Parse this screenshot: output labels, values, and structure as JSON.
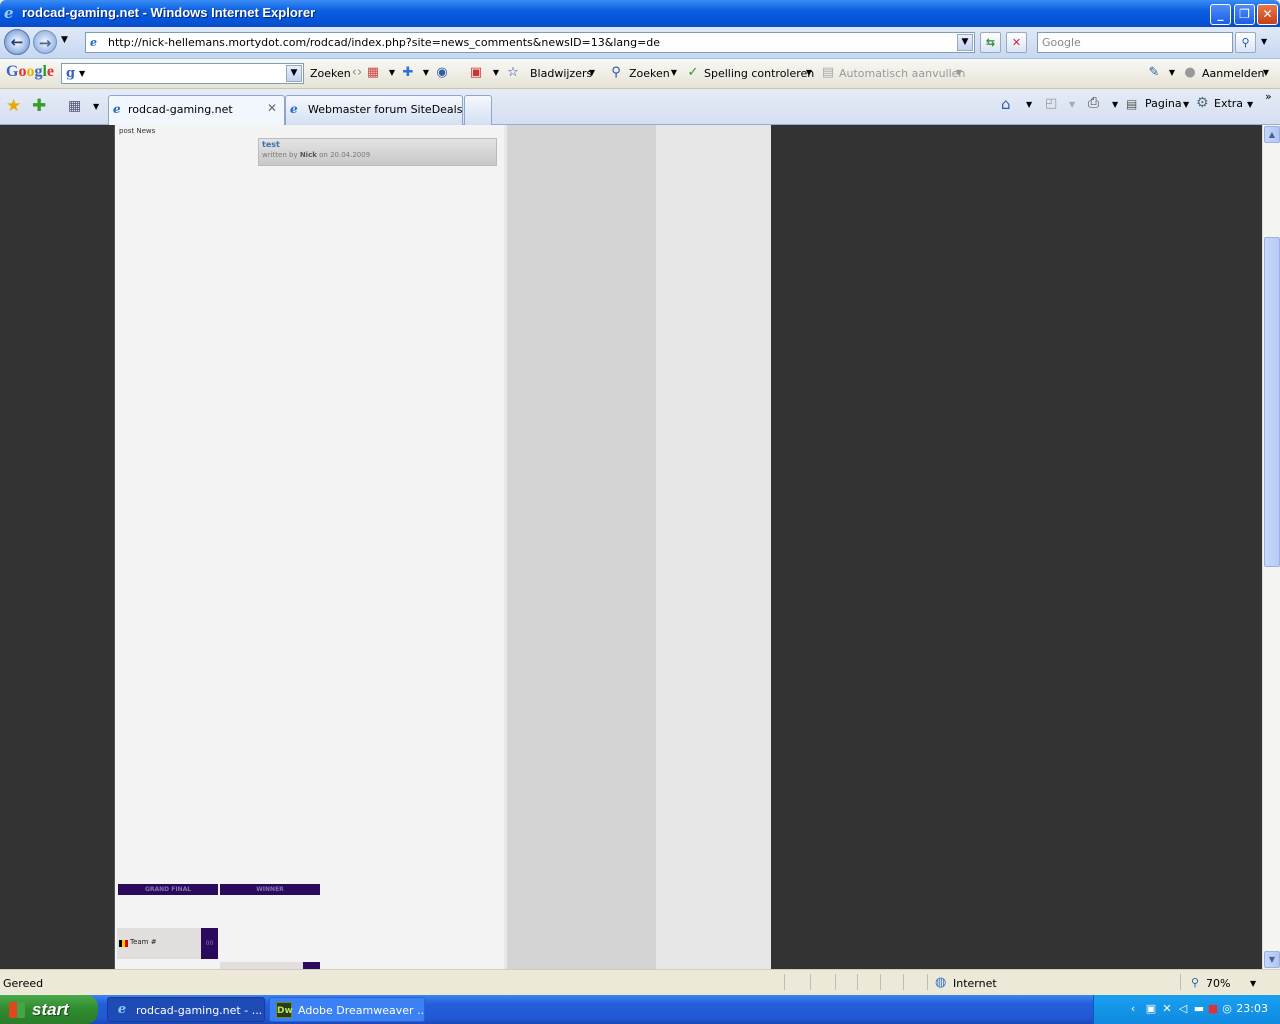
{
  "window": {
    "title": "rodcad-gaming.net - Windows Internet Explorer"
  },
  "navbar": {
    "url": "http://nick-hellemans.mortydot.com/rodcad/index.php?site=news_comments&newsID=13&lang=de",
    "search_placeholder": "Google"
  },
  "google_toolbar": {
    "logo": "Google",
    "search_label": "Zoeken",
    "bookmarks_label": "Bladwijzers",
    "find_label": "Zoeken",
    "spellcheck_label": "Spelling controleren",
    "autofill_label": "Automatisch aanvullen",
    "signin_label": "Aanmelden"
  },
  "tabs": [
    {
      "label": "rodcad-gaming.net",
      "active": true
    },
    {
      "label": "Webmaster forum SiteDeals",
      "active": false
    }
  ],
  "command_bar": {
    "page_label": "Pagina",
    "tools_label": "Extra"
  },
  "page": {
    "post_news_label": "post News",
    "news": {
      "title": "test",
      "written_by_prefix": "written by",
      "author": "Nick",
      "date_prefix": "on",
      "date": "20.04.2009"
    },
    "bracket": {
      "grand_final_label": "GRAND FINAL",
      "winner_label": "WINNER",
      "team_name": "Team #",
      "team_score": "00"
    }
  },
  "statusbar": {
    "status": "Gereed",
    "zone": "Internet",
    "zoom": "70%"
  },
  "taskbar": {
    "start_label": "start",
    "tasks": [
      {
        "label": "rodcad-gaming.net - ...",
        "active": true
      },
      {
        "label": "Adobe Dreamweaver ...",
        "active": false
      }
    ],
    "clock": "23:03"
  },
  "colors": {
    "page_background": "#333333",
    "content_column": "#f3f3f3",
    "bracket_purple": "#2a0a5c",
    "link_blue": "#3a6fb0"
  },
  "icons": [
    "ie-icon",
    "back-arrow-icon",
    "forward-arrow-icon",
    "refresh-icon",
    "stop-icon",
    "search-icon",
    "star-icon",
    "add-favorite-icon",
    "home-icon",
    "feed-icon",
    "print-icon",
    "page-icon",
    "gear-icon",
    "wrench-icon",
    "globe-icon",
    "zoom-icon"
  ]
}
